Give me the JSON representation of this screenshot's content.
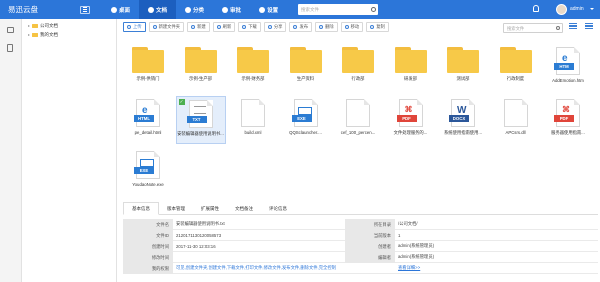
{
  "app": {
    "brand": "易迅云盘",
    "user": "admin"
  },
  "nav": [
    {
      "label": "桌面",
      "active": false
    },
    {
      "label": "文档",
      "active": true
    },
    {
      "label": "分类",
      "active": false
    },
    {
      "label": "审批",
      "active": false
    },
    {
      "label": "设置",
      "active": false
    }
  ],
  "top_search": {
    "placeholder": "搜索文件"
  },
  "tree": [
    {
      "label": "公司文档"
    },
    {
      "label": "我的文档"
    }
  ],
  "toolbar": [
    {
      "label": "上传",
      "icon": "upload-icon"
    },
    {
      "label": "新建文件夹",
      "icon": "new-folder-icon"
    },
    {
      "label": "新建",
      "icon": "new-icon"
    },
    {
      "label": "刷新",
      "icon": "refresh-icon"
    },
    {
      "label": "下载",
      "icon": "download-icon"
    },
    {
      "label": "分享",
      "icon": "share-icon"
    },
    {
      "label": "发布",
      "icon": "publish-icon"
    },
    {
      "label": "删除",
      "icon": "delete-icon"
    },
    {
      "label": "移动",
      "icon": "move-icon"
    },
    {
      "label": "复制",
      "icon": "copy-icon"
    }
  ],
  "file_search": {
    "placeholder": "搜索文件"
  },
  "files": [
    {
      "name": "示例-供销门",
      "kind": "folder"
    },
    {
      "name": "示例-生产部",
      "kind": "folder"
    },
    {
      "name": "示例-财务部",
      "kind": "folder"
    },
    {
      "name": "生产资料",
      "kind": "folder"
    },
    {
      "name": "行政部",
      "kind": "folder"
    },
    {
      "name": "研发部",
      "kind": "folder"
    },
    {
      "name": "测试部",
      "kind": "folder"
    },
    {
      "name": "行政制度",
      "kind": "folder"
    },
    {
      "name": "AddEmotion.htm",
      "kind": "htm"
    },
    {
      "name": "pe_detail.html",
      "kind": "html"
    },
    {
      "name": "安装编辑器使用说明书...",
      "kind": "txt",
      "selected": true
    },
    {
      "name": "build.xml",
      "kind": "blank"
    },
    {
      "name": "QQSclauncher....",
      "kind": "exe"
    },
    {
      "name": "cef_100_percen...",
      "kind": "blank"
    },
    {
      "name": "文件处理服务的...",
      "kind": "pdf"
    },
    {
      "name": "系统使用指南使用...",
      "kind": "docx"
    },
    {
      "name": "APCsrs.dll",
      "kind": "blank"
    },
    {
      "name": "服务器使用指南...",
      "kind": "pdf"
    },
    {
      "name": "YoudaoNote.exe",
      "kind": "exe"
    }
  ],
  "badges": {
    "htm": "HTM",
    "html": "HTML",
    "txt": "TXT",
    "exe": "EXE",
    "pdf": "PDF",
    "docx": "DOCX"
  },
  "detail_tabs": [
    "基本信息",
    "版本管理",
    "扩展属性",
    "文档备注",
    "评论信息"
  ],
  "details": {
    "file_name_label": "文件名",
    "file_name": "安装编辑器使用说明书.txt",
    "location_label": "所在目录",
    "location": "/公司文档/",
    "file_id_label": "文件ID",
    "file_id": "2120171130120058573",
    "version_label": "当前版本",
    "version": "1",
    "created_label": "创建时间",
    "created": "2017-11-30 12:03:16",
    "creator_label": "创建者",
    "creator": "admin(系统管理员)",
    "modified_label": "修改时间",
    "modified": "",
    "editor_label": "编辑者",
    "editor": "admin(系统管理员)",
    "perm_label": "我的权限",
    "perm": "可见,创建文件夹,创建文件,下载文件,打印文件,修改文件,发布文件,删除文件,完全控制",
    "more": "查看详细>>"
  },
  "colors": {
    "topbar": "#2c76d9",
    "folder": "#f7c948",
    "pdf": "#e0453a",
    "exe": "#2b7cd3",
    "docx": "#2b579a"
  }
}
